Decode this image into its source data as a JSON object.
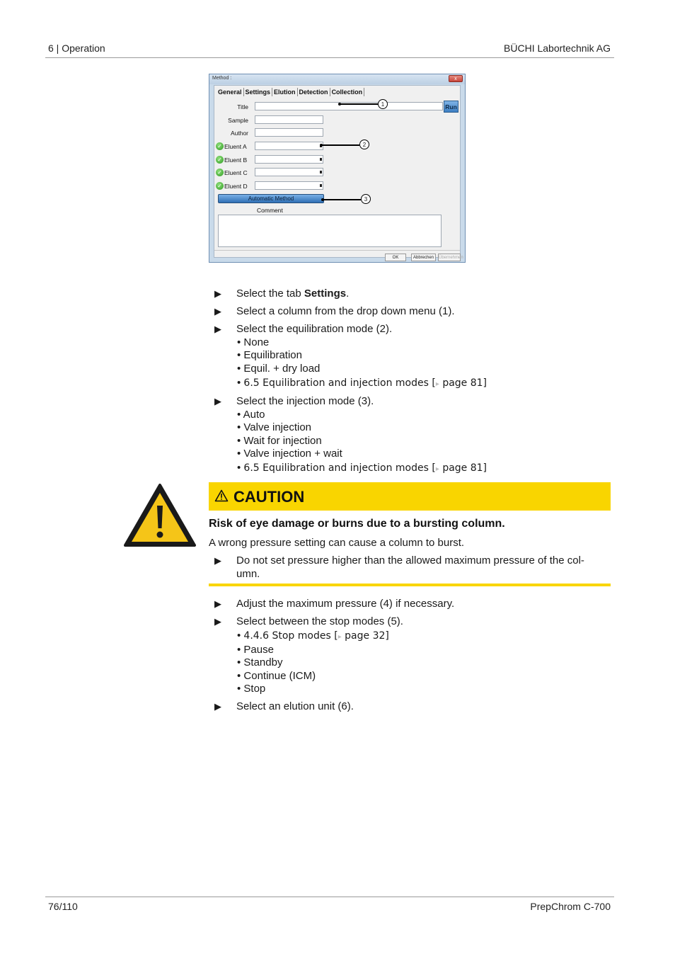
{
  "header": {
    "left": "6 | Operation",
    "right": "BÜCHI Labortechnik AG"
  },
  "footer": {
    "left": "76/110",
    "right": "PrepChrom C-700"
  },
  "dialog": {
    "title": "Method :",
    "close_label": "x",
    "tabs": [
      "General",
      "Settings",
      "Elution",
      "Detection",
      "Collection"
    ],
    "fields": {
      "title": "Title",
      "sample": "Sample",
      "author": "Author",
      "eluent_a": "Eluent A",
      "eluent_b": "Eluent B",
      "eluent_c": "Eluent C",
      "eluent_d": "Eluent D"
    },
    "run_label": "Run",
    "automatic_method_label": "Automatic Method",
    "comment_label": "Comment",
    "ok_label": "OK",
    "cancel_label": "Abbrechen",
    "apply_label": "Übernehmen",
    "callouts": [
      "1",
      "2",
      "3"
    ]
  },
  "steps1": [
    {
      "pre": "Select the tab ",
      "bold": "Settings",
      "post": "."
    },
    {
      "text": "Select a column from the drop down menu (1)."
    },
    {
      "text": "Select the equilibration mode (2)."
    }
  ],
  "equil_options": [
    "• None",
    "• Equilibration",
    "• Equil. + dry load"
  ],
  "xref_equil": {
    "bullet": "• ",
    "text": "6.5 Equilibration and injection modes [",
    "page": " page 81]"
  },
  "step_injection": "Select the injection mode (3).",
  "injection_options": [
    "• Auto",
    "• Valve injection",
    "• Wait for injection",
    "• Valve injection + wait"
  ],
  "caution": {
    "title": "CAUTION",
    "heading": "Risk of eye damage or burns due to a bursting column.",
    "text": "A wrong pressure setting can cause a column to burst.",
    "instruction_line1": "Do not set pressure higher than the allowed maximum pressure of the col-",
    "instruction_line2": "umn.",
    "color": "#f9d500"
  },
  "steps2": {
    "pressure": "Adjust the maximum pressure (4) if necessary.",
    "stop_modes": "Select between the stop modes (5).",
    "xref_stop": {
      "bullet": "• ",
      "text": "4.4.6 Stop modes [",
      "page": " page 32]"
    },
    "stop_options": [
      "• Pause",
      "• Standby",
      "• Continue (ICM)",
      "• Stop"
    ],
    "elution_unit": "Select an elution unit (6)."
  },
  "icons": {
    "arrow": "▶",
    "xref_arrow": "▸",
    "warning": "warning-triangle"
  }
}
